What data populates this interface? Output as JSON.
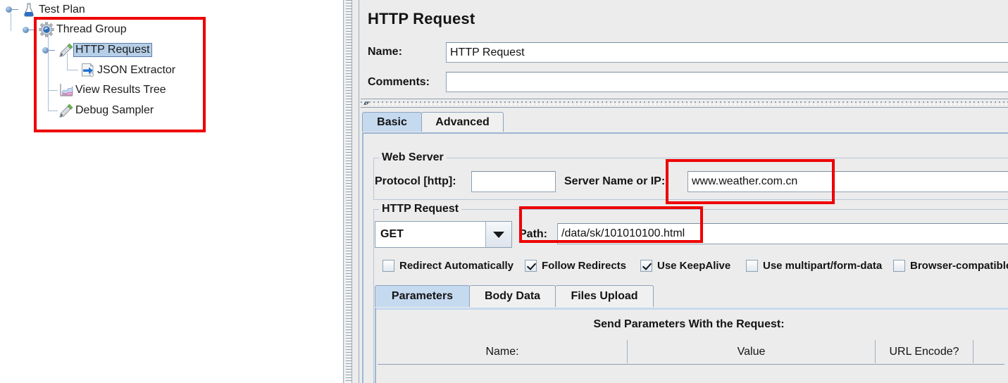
{
  "tree": {
    "items": [
      {
        "label": "Test Plan",
        "icon": "test-plan-flask-icon",
        "selected": false
      },
      {
        "label": "Thread Group",
        "icon": "thread-group-gear-icon",
        "selected": false
      },
      {
        "label": "HTTP Request",
        "icon": "http-sampler-pipette-icon",
        "selected": true
      },
      {
        "label": "JSON Extractor",
        "icon": "json-extractor-icon",
        "selected": false
      },
      {
        "label": "View Results Tree",
        "icon": "view-results-tree-icon",
        "selected": false
      },
      {
        "label": "Debug Sampler",
        "icon": "debug-sampler-pipette-icon",
        "selected": false
      }
    ]
  },
  "panel": {
    "title": "HTTP Request",
    "name_label": "Name:",
    "name_value": "HTTP Request",
    "comments_label": "Comments:",
    "comments_value": ""
  },
  "main_tabs": [
    {
      "label": "Basic",
      "active": true
    },
    {
      "label": "Advanced",
      "active": false
    }
  ],
  "web_server": {
    "group_title": "Web Server",
    "protocol_label": "Protocol [http]:",
    "protocol_value": "",
    "server_label": "Server Name or IP:",
    "server_value": "www.weather.com.cn"
  },
  "http_request": {
    "group_title": "HTTP Request",
    "method_value": "GET",
    "path_label": "Path:",
    "path_value": "/data/sk/101010100.html",
    "checkboxes": [
      {
        "label": "Redirect Automatically",
        "checked": false
      },
      {
        "label": "Follow Redirects",
        "checked": true
      },
      {
        "label": "Use KeepAlive",
        "checked": true
      },
      {
        "label": "Use multipart/form-data",
        "checked": false
      },
      {
        "label": "Browser-compatible",
        "checked": false
      }
    ]
  },
  "sub_tabs": [
    {
      "label": "Parameters",
      "active": true
    },
    {
      "label": "Body Data",
      "active": false
    },
    {
      "label": "Files Upload",
      "active": false
    }
  ],
  "params_table": {
    "title": "Send Parameters With the Request:",
    "columns": [
      "Name:",
      "Value",
      "URL Encode?"
    ],
    "rows": []
  },
  "colors": {
    "panel_bg": "#ececec",
    "selection_blue": "#b6cfe8",
    "active_tab_blue": "#c5d9ef",
    "highlight_red": "#ee0000",
    "field_white": "#ffffff"
  }
}
